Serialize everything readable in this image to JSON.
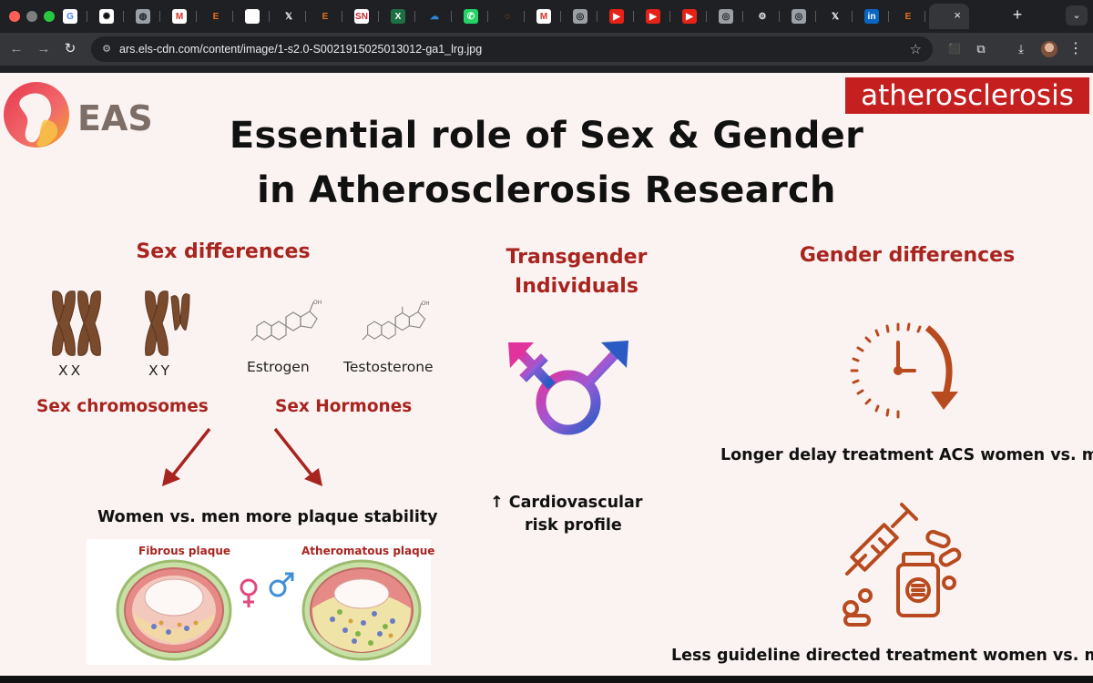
{
  "browser": {
    "tabs": [
      {
        "icon": "google-icon",
        "color": "#ffffff",
        "glyph": "G",
        "fg": "#4285f4"
      },
      {
        "icon": "openai-icon",
        "color": "#ffffff",
        "glyph": "✺",
        "fg": "#111111"
      },
      {
        "icon": "globe-icon",
        "color": "#9aa0a6",
        "glyph": "◍",
        "fg": "#202124"
      },
      {
        "icon": "gmail-icon",
        "color": "#ffffff",
        "glyph": "M",
        "fg": "#d93025"
      },
      {
        "icon": "elsevier-icon",
        "color": "#1f2023",
        "glyph": "E",
        "fg": "#e9711c"
      },
      {
        "icon": "blank-page-icon",
        "color": "#ffffff",
        "glyph": "",
        "fg": "#ffffff"
      },
      {
        "icon": "x-icon",
        "color": "#1f2023",
        "glyph": "𝕏",
        "fg": "#ffffff"
      },
      {
        "icon": "elsevier-icon",
        "color": "#1f2023",
        "glyph": "E",
        "fg": "#e9711c"
      },
      {
        "icon": "sn-icon",
        "color": "#ffffff",
        "glyph": "SN",
        "fg": "#c0282d"
      },
      {
        "icon": "excel-icon",
        "color": "#1d7044",
        "glyph": "X",
        "fg": "#ffffff"
      },
      {
        "icon": "onedrive-icon",
        "color": "#1f2023",
        "glyph": "☁",
        "fg": "#2b88d8"
      },
      {
        "icon": "whatsapp-icon",
        "color": "#25d366",
        "glyph": "✆",
        "fg": "#ffffff"
      },
      {
        "icon": "loading-icon",
        "color": "#1f2023",
        "glyph": "◌",
        "fg": "#e9711c"
      },
      {
        "icon": "gmail-icon",
        "color": "#ffffff",
        "glyph": "M",
        "fg": "#d93025"
      },
      {
        "icon": "chrome-icon",
        "color": "#9aa0a6",
        "glyph": "◎",
        "fg": "#202124"
      },
      {
        "icon": "youtube-icon",
        "color": "#e62117",
        "glyph": "▶",
        "fg": "#ffffff"
      },
      {
        "icon": "youtube-icon",
        "color": "#e62117",
        "glyph": "▶",
        "fg": "#ffffff"
      },
      {
        "icon": "youtube-icon",
        "color": "#e62117",
        "glyph": "▶",
        "fg": "#ffffff"
      },
      {
        "icon": "chrome-icon",
        "color": "#9aa0a6",
        "glyph": "◎",
        "fg": "#202124"
      },
      {
        "icon": "gear-icon",
        "color": "#1f2023",
        "glyph": "⚙",
        "fg": "#e8eaed"
      },
      {
        "icon": "chrome-icon",
        "color": "#9aa0a6",
        "glyph": "◎",
        "fg": "#202124"
      },
      {
        "icon": "x-icon",
        "color": "#1f2023",
        "glyph": "𝕏",
        "fg": "#ffffff"
      },
      {
        "icon": "linkedin-icon",
        "color": "#0a66c2",
        "glyph": "in",
        "fg": "#ffffff"
      },
      {
        "icon": "elsevier-icon",
        "color": "#1f2023",
        "glyph": "E",
        "fg": "#e9711c"
      }
    ],
    "active_tab": {
      "close": "×"
    },
    "new_tab": "+",
    "tab_search": "⌄",
    "url": "ars.els-cdn.com/content/image/1-s2.0-S0021915025013012-ga1_lrg.jpg",
    "nav": {
      "back": "←",
      "forward": "→",
      "reload": "↻"
    },
    "toolbar_icons": {
      "star": "☆",
      "lock_ext": "⬛",
      "extensions": "⧉",
      "download": "⤓",
      "menu": "⋮"
    }
  },
  "abstract": {
    "journal": "atherosclerosis",
    "society": "EAS",
    "title_line1": "Essential role of Sex  &  Gender",
    "title_line2": "in Atherosclerosis Research",
    "sex_differences": {
      "heading": "Sex differences",
      "chrom_xx": "XX",
      "chrom_xy": "XY",
      "estrogen": "Estrogen",
      "testosterone": "Testosterone",
      "sex_chromosomes": "Sex chromosomes",
      "sex_hormones": "Sex Hormones",
      "conclusion": "Women  vs. men more plaque stability",
      "fibrous_plaque": "Fibrous plaque",
      "atheromatous_plaque": "Atheromatous plaque"
    },
    "transgender": {
      "heading_line1": "Transgender",
      "heading_line2": "Individuals",
      "risk_line1": "↑ Cardiovascular",
      "risk_line2": "risk profile"
    },
    "gender_differences": {
      "heading": "Gender differences",
      "delay": "Longer delay treatment ACS women vs. men",
      "guideline": "Less guideline directed treatment women vs. men"
    },
    "colors": {
      "accent_red": "#a8241f",
      "journal_red": "#c5201f",
      "chromosome_brown": "#7a4a2c",
      "icon_orange": "#b84a1f"
    }
  }
}
